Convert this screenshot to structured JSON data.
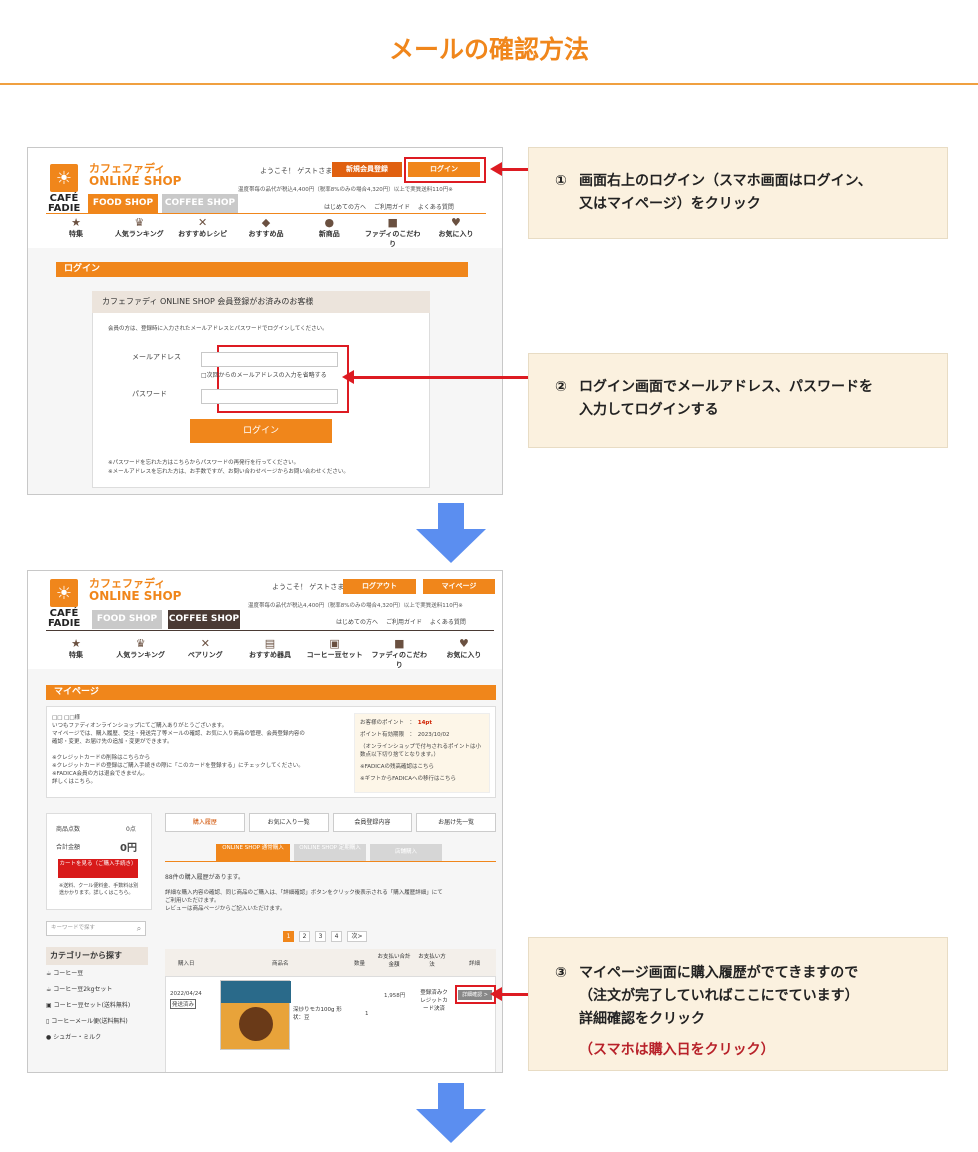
{
  "page_title": "メールの確認方法",
  "steps": [
    {
      "num": "①",
      "lines": [
        "画面右上のログイン（スマホ画面はログイン、",
        "又はマイページ）をクリック"
      ]
    },
    {
      "num": "②",
      "lines": [
        "ログイン画面でメールアドレス、パスワードを",
        "入力してログインする"
      ]
    },
    {
      "num": "③",
      "lines": [
        "マイページ画面に購入履歴がでてきますので",
        "（注文が完了していればここにでています）",
        "詳細確認をクリック"
      ],
      "note": "（スマホは購入日をクリック）"
    }
  ],
  "site": {
    "brand_jp": "カフェファディ",
    "brand_en": "ONLINE SHOP",
    "logo_word1": "CAFÉ",
    "logo_word2": "FADIE",
    "welcome": "ようこそ！ ゲストさま",
    "shipping_note": "温度帯毎の品代が税込4,400円（税率8%のみの場合4,320円）以上で実質送料110円※",
    "tab_food": "FOOD SHOP",
    "tab_coffee": "COFFEE SHOP",
    "links": [
      "はじめての方へ",
      "ご利用ガイド",
      "よくある質問"
    ]
  },
  "shot1": {
    "btn_register": "新規会員登録",
    "btn_login": "ログイン",
    "nav": [
      "特集",
      "人気ランキング",
      "おすすめレシピ",
      "おすすめ品",
      "新商品",
      "ファディのこだわり",
      "お気に入り"
    ],
    "section": "ログイン",
    "panel_title": "カフェファディ ONLINE SHOP 会員登録がお済みのお客様",
    "panel_desc": "会員の方は、登録時に入力されたメールアドレスとパスワードでログインしてください。",
    "label_email": "メールアドレス",
    "remember": "□次回からのメールアドレスの入力を省略する",
    "label_pass": "パスワード",
    "submit": "ログイン",
    "note1": "※パスワードを忘れた方はこちらからパスワードの再発行を行ってください。",
    "note2": "※メールアドレスを忘れた方は、お手数ですが、お問い合わせページからお問い合わせください。"
  },
  "shot2": {
    "btn_logout": "ログアウト",
    "btn_mypage": "マイページ",
    "nav": [
      "特集",
      "人気ランキング",
      "ペアリング",
      "おすすめ器具",
      "コーヒー豆セット",
      "ファディのこだわり",
      "お気に入り"
    ],
    "section": "マイページ",
    "greeting": [
      "□□ □□様",
      "いつもファディオンラインショップにてご購入ありがとうございます。",
      "マイページでは、購入履歴、受注・発送完了等メールの確認、お気に入り商品の管理、会員登録内容の",
      "確認・変更、お届け先の追加・変更ができます。",
      "",
      "※クレジットカードの削除はこちらから",
      "※クレジットカードの登録はご購入手続きの際に「このカードを登録する」にチェックしてください。",
      "※FADICA会員の方は退会できません。",
      "詳しくはこちら。"
    ],
    "points_label": "お客様のポイント",
    "points_value": "14pt",
    "expiry_label": "ポイント有効期限",
    "expiry_value": "2023/10/02",
    "points_note": "（オンラインショップで付与されるポイントは小数点以下切り捨てとなります。）",
    "fadica1": "※FADICAの残高確認はこちら",
    "fadica2": "※ギフトからFADICAへの移行はこちら",
    "cart_count_label": "商品点数",
    "cart_count": "0点",
    "cart_total_label": "合計金額",
    "cart_total": "0円",
    "cart_btn": "カートを見る（ご購入手続き）",
    "cart_note": "※送料、クール便料金、手数料は別途かかります。詳しくはこちら。",
    "search_ph": "キーワードで探す",
    "cat_title": "カテゴリーから探す",
    "categories": [
      "コーヒー豆",
      "コーヒー豆2kgセット",
      "コーヒー豆セット(送料無料)",
      "コーヒーメール便(送料無料)",
      "シュガー・ミルク"
    ],
    "subtabs": [
      "購入履歴",
      "お気に入り一覧",
      "会員登録内容",
      "お届け先一覧"
    ],
    "shop_tabs": [
      "ONLINE SHOP 通常購入",
      "ONLINE SHOP 定期購入",
      "店舗購入"
    ],
    "history_count": "88件の購入履歴があります。",
    "history_desc": [
      "詳細な購入内容の確認、同じ商品のご購入は、「詳細確認」ボタンをクリック後表示される「購入履歴詳細」にて",
      "ご利用いただけます。",
      "レビューは商品ページからご記入いただけます。"
    ],
    "pages": [
      "1",
      "2",
      "3",
      "4",
      "次>"
    ],
    "table_headers": [
      "購入日",
      "商品名",
      "数量",
      "お支払い合計金額",
      "お支払い方法",
      "詳細"
    ],
    "row": {
      "date": "2022/04/24",
      "status": "発送済み",
      "product": "深炒りモカ100g 形状：豆",
      "qty": "1",
      "amount": "1,958円",
      "method": "登録済みクレジットカード決済",
      "detail_btn": "詳細確認 >"
    }
  }
}
